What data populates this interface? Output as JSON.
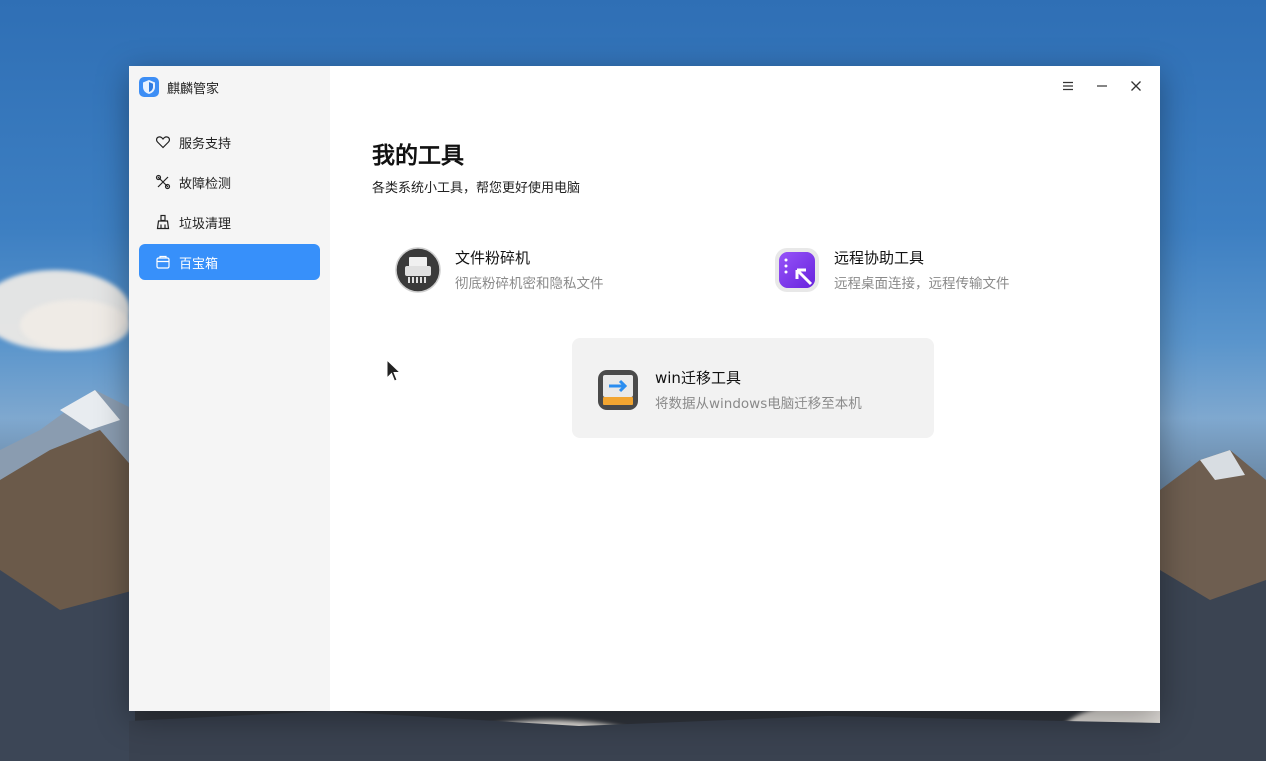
{
  "app": {
    "title": "麒麟管家"
  },
  "sidebar": {
    "items": [
      {
        "label": "服务支持",
        "icon": "heart-icon",
        "active": false
      },
      {
        "label": "故障检测",
        "icon": "tools-icon",
        "active": false
      },
      {
        "label": "垃圾清理",
        "icon": "broom-icon",
        "active": false
      },
      {
        "label": "百宝箱",
        "icon": "toolbox-icon",
        "active": true
      }
    ]
  },
  "window_controls": [
    "menu-icon",
    "minimize-icon",
    "close-icon"
  ],
  "main": {
    "title": "我的工具",
    "subtitle": "各类系统小工具，帮您更好使用电脑",
    "tools": [
      {
        "name": "文件粉碎机",
        "description": "彻底粉碎机密和隐私文件",
        "icon": "shredder-icon"
      },
      {
        "name": "远程协助工具",
        "description": "远程桌面连接，远程传输文件",
        "icon": "remote-assist-icon"
      },
      {
        "name": "win迁移工具",
        "description": "将数据从windows电脑迁移至本机",
        "icon": "migration-icon"
      }
    ]
  },
  "colors": {
    "accent": "#3790fa",
    "sidebar_bg": "#f5f5f5",
    "hover_bg": "#f2f2f2",
    "muted_text": "#8a8a8a"
  }
}
